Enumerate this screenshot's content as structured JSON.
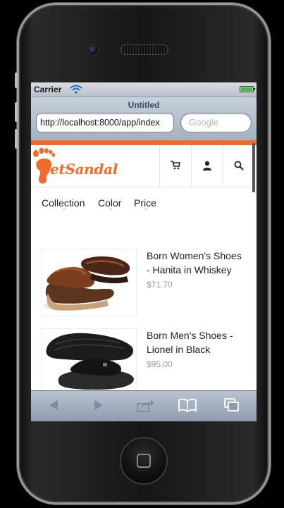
{
  "status_bar": {
    "carrier": "Carrier",
    "battery_level": 1.0
  },
  "browser": {
    "page_title": "Untitled",
    "url": "http://localhost:8000/app/index",
    "search_placeholder": "Google"
  },
  "site": {
    "logo_text": "etSandal",
    "brand_color": "#f26b2c",
    "header_icons": [
      "cart-icon",
      "user-icon",
      "search-icon"
    ]
  },
  "filters": [
    {
      "label": "Collection"
    },
    {
      "label": "Color"
    },
    {
      "label": "Price"
    }
  ],
  "products": [
    {
      "name": "Born Women's Shoes - Hanita in Whiskey",
      "price": "$71.70",
      "image": "brown-leather-sandal"
    },
    {
      "name": "Born Men's Shoes - Lionel in Black",
      "price": "$95.00",
      "image": "black-leather-slide"
    }
  ],
  "toolbar": [
    "back-icon",
    "forward-icon",
    "share-icon",
    "bookmarks-icon",
    "tabs-icon"
  ]
}
